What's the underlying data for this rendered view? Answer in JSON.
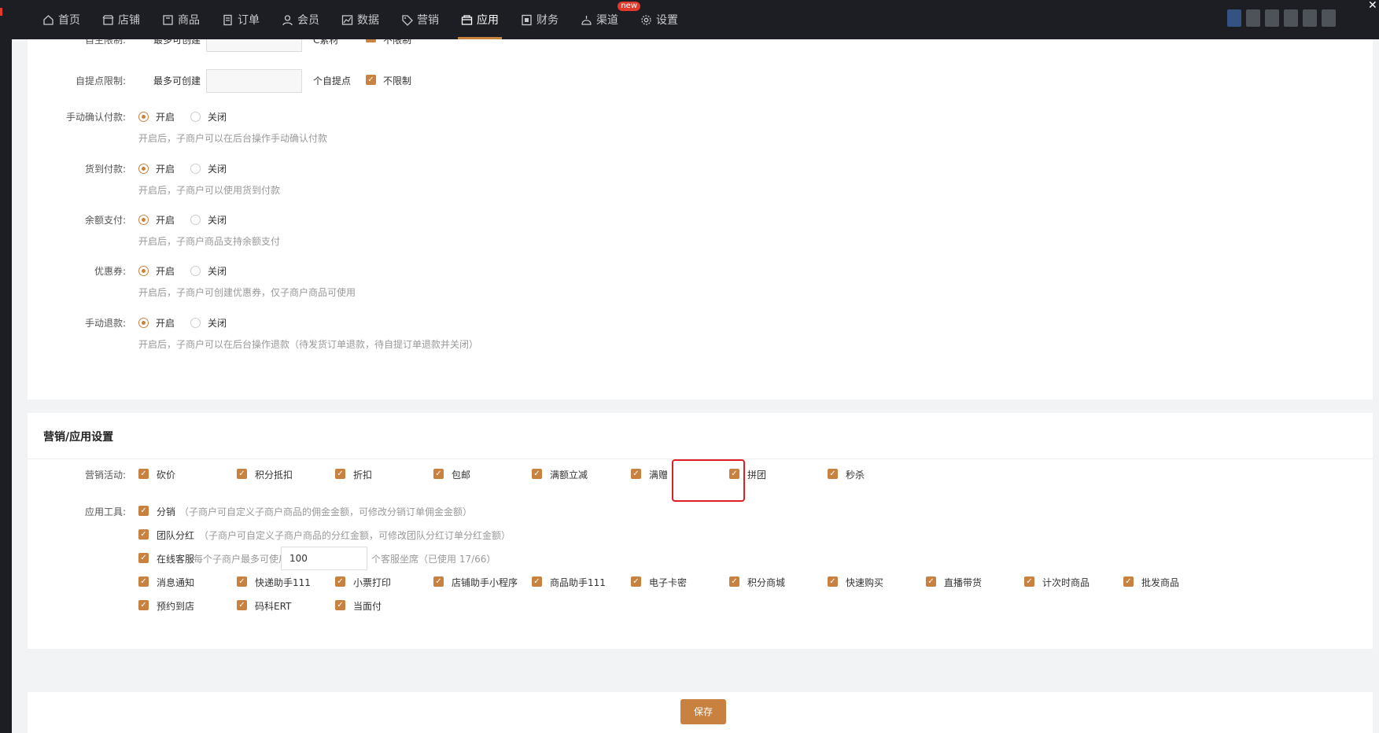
{
  "nav": [
    {
      "label": "首页",
      "icon": "home-icon"
    },
    {
      "label": "店铺",
      "icon": "store-icon"
    },
    {
      "label": "商品",
      "icon": "product-icon"
    },
    {
      "label": "订单",
      "icon": "order-icon"
    },
    {
      "label": "会员",
      "icon": "user-icon"
    },
    {
      "label": "数据",
      "icon": "chart-icon"
    },
    {
      "label": "营销",
      "icon": "tag-icon"
    },
    {
      "label": "应用",
      "icon": "app-icon"
    },
    {
      "label": "财务",
      "icon": "finance-icon"
    },
    {
      "label": "渠道",
      "icon": "channel-icon",
      "badge": "new"
    },
    {
      "label": "设置",
      "icon": "gear-icon"
    }
  ],
  "active_nav": "应用",
  "accent": "#c9813f",
  "partial_row": {
    "label": "自主限制:",
    "prefix": "最多可创建",
    "unit": "C素材",
    "check": "不限制"
  },
  "pickup": {
    "label": "自提点限制:",
    "prefix": "最多可创建",
    "unit": "个自提点",
    "check": "不限制",
    "value": ""
  },
  "radio_rows": [
    {
      "label": "手动确认付款:",
      "on": "开启",
      "off": "关闭",
      "hint": "开启后，子商户可以在后台操作手动确认付款"
    },
    {
      "label": "货到付款:",
      "on": "开启",
      "off": "关闭",
      "hint": "开启后，子商户可以使用货到付款"
    },
    {
      "label": "余额支付:",
      "on": "开启",
      "off": "关闭",
      "hint": "开启后，子商户商品支持余额支付"
    },
    {
      "label": "优惠券:",
      "on": "开启",
      "off": "关闭",
      "hint": "开启后，子商户可创建优惠券，仅子商户商品可使用"
    },
    {
      "label": "手动退款:",
      "on": "开启",
      "off": "关闭",
      "hint": "开启后，子商户可以在后台操作退款（待发货订单退款，待自提订单退款并关闭）"
    }
  ],
  "section_title": "营销/应用设置",
  "marketing": {
    "label": "营销活动:",
    "items": [
      "砍价",
      "积分抵扣",
      "折扣",
      "包邮",
      "满额立减",
      "满赠",
      "拼团",
      "秒杀"
    ]
  },
  "tools": {
    "label": "应用工具:",
    "fenxiao": {
      "name": "分销",
      "desc": "（子商户可自定义子商户商品的佣金金额，可修改分销订单佣金金额）"
    },
    "team": {
      "name": "团队分红",
      "desc": "（子商户可自定义子商户商品的分红金额，可修改团队分红订单分红金额）"
    },
    "service": {
      "name": "在线客服",
      "pre": "每个子商户最多可使用",
      "value": "100",
      "post": "个客服坐席（已使用 17/66）"
    },
    "row1": [
      "消息通知",
      "快递助手111",
      "小票打印",
      "店铺助手小程序",
      "商品助手111",
      "电子卡密",
      "积分商城",
      "快速购买",
      "直播带货",
      "计次时商品",
      "批发商品"
    ],
    "row2": [
      "预约到店",
      "码科ERT",
      "当面付"
    ]
  },
  "save": "保存"
}
